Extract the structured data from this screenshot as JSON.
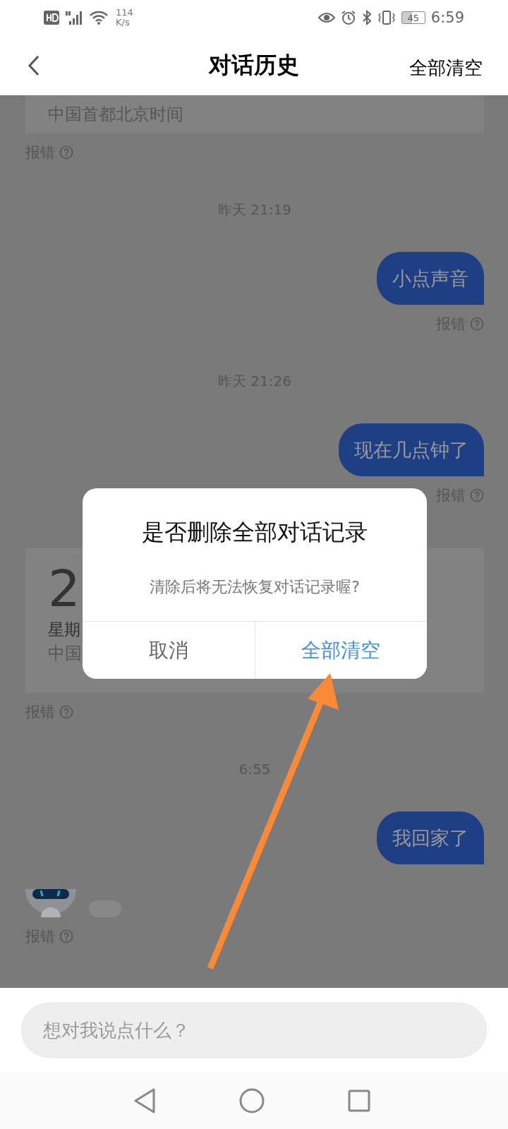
{
  "status_bar": {
    "speed": "114",
    "speed_unit": "K/s",
    "battery": "45",
    "time": "6:59"
  },
  "header": {
    "title": "对话历史",
    "action": "全部清空"
  },
  "messages": [
    {
      "kind": "card",
      "lines": [
        "中国首都北京时间"
      ]
    },
    {
      "kind": "report",
      "label": "报错"
    },
    {
      "kind": "time",
      "text": "昨天 21:19"
    },
    {
      "kind": "user",
      "text": "小点声音"
    },
    {
      "kind": "report",
      "label": "报错"
    },
    {
      "kind": "time",
      "text": "昨天 21:26"
    },
    {
      "kind": "user",
      "text": "现在几点钟了"
    },
    {
      "kind": "report",
      "label": "报错"
    },
    {
      "kind": "card",
      "big": "2",
      "lines": [
        "星期",
        "中国"
      ]
    },
    {
      "kind": "report",
      "label": "报错"
    },
    {
      "kind": "time",
      "text": "6:55"
    },
    {
      "kind": "user",
      "text": "我回家了"
    },
    {
      "kind": "bot"
    },
    {
      "kind": "report",
      "label": "报错"
    }
  ],
  "dialog": {
    "title": "是否删除全部对话记录",
    "message": "清除后将无法恢复对话记录喔?",
    "buttons": [
      {
        "label": "取消",
        "kind": "cancel"
      },
      {
        "label": "全部清空",
        "kind": "confirm"
      }
    ]
  },
  "input": {
    "placeholder": "想对我说点什么？"
  }
}
